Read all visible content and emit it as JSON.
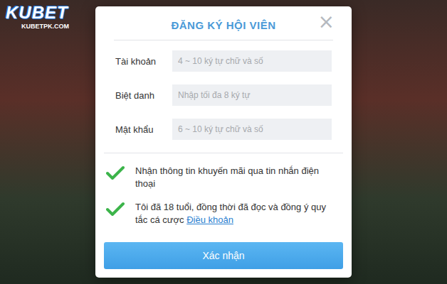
{
  "logo": {
    "name": "KUBET",
    "site": "KUBETPK.COM"
  },
  "dialog": {
    "title": "ĐĂNG KÝ HỘI VIÊN",
    "close": "×",
    "fields": [
      {
        "label": "Tài khoản",
        "placeholder": "4 ~ 10 ký tự chữ và số"
      },
      {
        "label": "Biệt danh",
        "placeholder": "Nhập tối đa 8 ký tự"
      },
      {
        "label": "Mật khẩu",
        "placeholder": "6 ~ 10 ký tự chữ và số"
      }
    ],
    "agreements": [
      {
        "text": "Nhận thông tin khuyến mãi qua tin nhắn điện thoại",
        "checked": true
      },
      {
        "text": "Tôi đã 18 tuổi, đồng thời đã đọc và đồng ý quy tắc cá cược",
        "link": "Điều khoản",
        "checked": true
      }
    ],
    "submit": "Xác nhận"
  }
}
